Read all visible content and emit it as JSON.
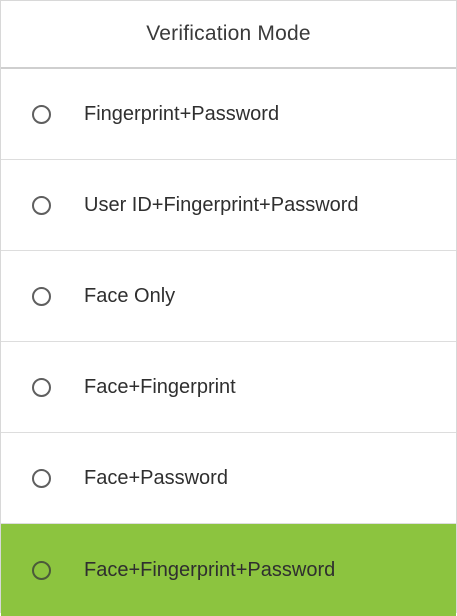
{
  "header": {
    "title": "Verification Mode"
  },
  "options": [
    {
      "label": "Fingerprint+Password",
      "selected": false
    },
    {
      "label": "User ID+Fingerprint+Password",
      "selected": false
    },
    {
      "label": "Face Only",
      "selected": false
    },
    {
      "label": "Face+Fingerprint",
      "selected": false
    },
    {
      "label": "Face+Password",
      "selected": false
    },
    {
      "label": "Face+Fingerprint+Password",
      "selected": true
    }
  ],
  "colors": {
    "selected_row": "#8cc43f",
    "divider": "#dddddd",
    "text": "#2f2f2f"
  },
  "icons": {
    "radio": "radio-circle-icon"
  }
}
